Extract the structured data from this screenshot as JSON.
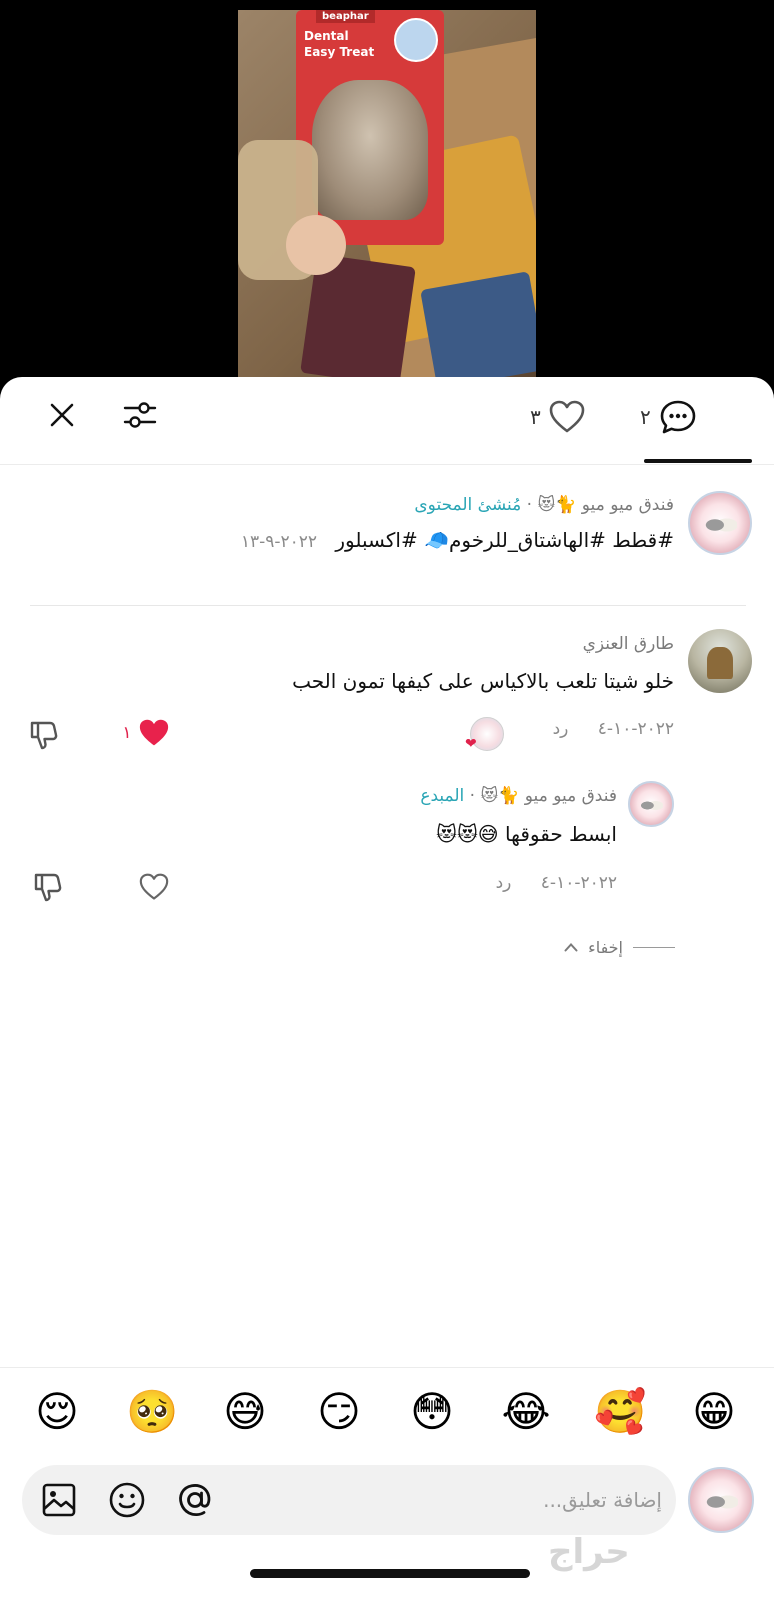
{
  "tabs": {
    "comments_count": "٢",
    "likes_count": "٣"
  },
  "creator_post": {
    "author": "فندق ميو ميو 🐈😻",
    "separator": "·",
    "role": "مُنشئ المحتوى",
    "text": "#قطط #الهاشتاق_للرخوم🧢 #اكسبلور",
    "date": "٢٠٢٢-٩-١٣"
  },
  "comment": {
    "author": "طارق العنزي",
    "text": "خلو شيتا تلعب بالاكياس على كيفها تمون الحب",
    "date": "٢٠٢٢-١٠-٤",
    "reply_label": "رد",
    "like_count": "١"
  },
  "reply": {
    "author": "فندق ميو ميو 🐈😻",
    "separator": "·",
    "role": "المبدع",
    "text": "ابسط حقوقها 😅😻😻",
    "date": "٢٠٢٢-١٠-٤",
    "reply_label": "رد"
  },
  "hide_label": "إخفاء",
  "emojis": [
    "😁",
    "🥰",
    "😂",
    "😳",
    "😏",
    "😅",
    "🥺",
    "😌"
  ],
  "input": {
    "placeholder": "إضافة تعليق..."
  },
  "video": {
    "brand": "beaphar",
    "product_title": "Dental Easy Treat"
  },
  "watermark": "حراج"
}
